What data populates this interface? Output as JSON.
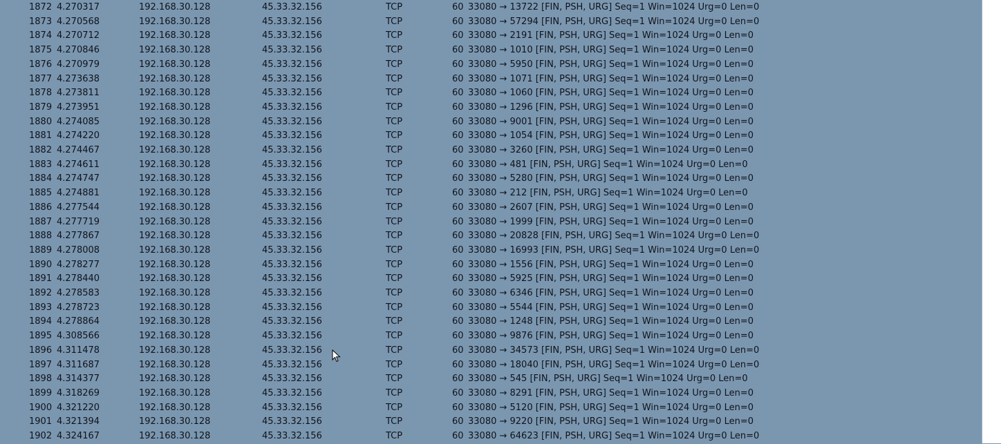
{
  "colors": {
    "row_background": "#7b97b0",
    "text": "#10131a",
    "gutter": "#ffffff"
  },
  "packets": [
    {
      "no": "1872",
      "time": "4.270317",
      "src": "192.168.30.128",
      "dst": "45.33.32.156",
      "proto": "TCP",
      "len": "60",
      "info": "33080 → 13722 [FIN, PSH, URG] Seq=1 Win=1024 Urg=0 Len=0"
    },
    {
      "no": "1873",
      "time": "4.270568",
      "src": "192.168.30.128",
      "dst": "45.33.32.156",
      "proto": "TCP",
      "len": "60",
      "info": "33080 → 57294 [FIN, PSH, URG] Seq=1 Win=1024 Urg=0 Len=0"
    },
    {
      "no": "1874",
      "time": "4.270712",
      "src": "192.168.30.128",
      "dst": "45.33.32.156",
      "proto": "TCP",
      "len": "60",
      "info": "33080 → 2191 [FIN, PSH, URG] Seq=1 Win=1024 Urg=0 Len=0"
    },
    {
      "no": "1875",
      "time": "4.270846",
      "src": "192.168.30.128",
      "dst": "45.33.32.156",
      "proto": "TCP",
      "len": "60",
      "info": "33080 → 1010 [FIN, PSH, URG] Seq=1 Win=1024 Urg=0 Len=0"
    },
    {
      "no": "1876",
      "time": "4.270979",
      "src": "192.168.30.128",
      "dst": "45.33.32.156",
      "proto": "TCP",
      "len": "60",
      "info": "33080 → 5950 [FIN, PSH, URG] Seq=1 Win=1024 Urg=0 Len=0"
    },
    {
      "no": "1877",
      "time": "4.273638",
      "src": "192.168.30.128",
      "dst": "45.33.32.156",
      "proto": "TCP",
      "len": "60",
      "info": "33080 → 1071 [FIN, PSH, URG] Seq=1 Win=1024 Urg=0 Len=0"
    },
    {
      "no": "1878",
      "time": "4.273811",
      "src": "192.168.30.128",
      "dst": "45.33.32.156",
      "proto": "TCP",
      "len": "60",
      "info": "33080 → 1060 [FIN, PSH, URG] Seq=1 Win=1024 Urg=0 Len=0"
    },
    {
      "no": "1879",
      "time": "4.273951",
      "src": "192.168.30.128",
      "dst": "45.33.32.156",
      "proto": "TCP",
      "len": "60",
      "info": "33080 → 1296 [FIN, PSH, URG] Seq=1 Win=1024 Urg=0 Len=0"
    },
    {
      "no": "1880",
      "time": "4.274085",
      "src": "192.168.30.128",
      "dst": "45.33.32.156",
      "proto": "TCP",
      "len": "60",
      "info": "33080 → 9001 [FIN, PSH, URG] Seq=1 Win=1024 Urg=0 Len=0"
    },
    {
      "no": "1881",
      "time": "4.274220",
      "src": "192.168.30.128",
      "dst": "45.33.32.156",
      "proto": "TCP",
      "len": "60",
      "info": "33080 → 1054 [FIN, PSH, URG] Seq=1 Win=1024 Urg=0 Len=0"
    },
    {
      "no": "1882",
      "time": "4.274467",
      "src": "192.168.30.128",
      "dst": "45.33.32.156",
      "proto": "TCP",
      "len": "60",
      "info": "33080 → 3260 [FIN, PSH, URG] Seq=1 Win=1024 Urg=0 Len=0"
    },
    {
      "no": "1883",
      "time": "4.274611",
      "src": "192.168.30.128",
      "dst": "45.33.32.156",
      "proto": "TCP",
      "len": "60",
      "info": "33080 → 481 [FIN, PSH, URG] Seq=1 Win=1024 Urg=0 Len=0"
    },
    {
      "no": "1884",
      "time": "4.274747",
      "src": "192.168.30.128",
      "dst": "45.33.32.156",
      "proto": "TCP",
      "len": "60",
      "info": "33080 → 5280 [FIN, PSH, URG] Seq=1 Win=1024 Urg=0 Len=0"
    },
    {
      "no": "1885",
      "time": "4.274881",
      "src": "192.168.30.128",
      "dst": "45.33.32.156",
      "proto": "TCP",
      "len": "60",
      "info": "33080 → 212 [FIN, PSH, URG] Seq=1 Win=1024 Urg=0 Len=0"
    },
    {
      "no": "1886",
      "time": "4.277544",
      "src": "192.168.30.128",
      "dst": "45.33.32.156",
      "proto": "TCP",
      "len": "60",
      "info": "33080 → 2607 [FIN, PSH, URG] Seq=1 Win=1024 Urg=0 Len=0"
    },
    {
      "no": "1887",
      "time": "4.277719",
      "src": "192.168.30.128",
      "dst": "45.33.32.156",
      "proto": "TCP",
      "len": "60",
      "info": "33080 → 1999 [FIN, PSH, URG] Seq=1 Win=1024 Urg=0 Len=0"
    },
    {
      "no": "1888",
      "time": "4.277867",
      "src": "192.168.30.128",
      "dst": "45.33.32.156",
      "proto": "TCP",
      "len": "60",
      "info": "33080 → 20828 [FIN, PSH, URG] Seq=1 Win=1024 Urg=0 Len=0"
    },
    {
      "no": "1889",
      "time": "4.278008",
      "src": "192.168.30.128",
      "dst": "45.33.32.156",
      "proto": "TCP",
      "len": "60",
      "info": "33080 → 16993 [FIN, PSH, URG] Seq=1 Win=1024 Urg=0 Len=0"
    },
    {
      "no": "1890",
      "time": "4.278277",
      "src": "192.168.30.128",
      "dst": "45.33.32.156",
      "proto": "TCP",
      "len": "60",
      "info": "33080 → 1556 [FIN, PSH, URG] Seq=1 Win=1024 Urg=0 Len=0"
    },
    {
      "no": "1891",
      "time": "4.278440",
      "src": "192.168.30.128",
      "dst": "45.33.32.156",
      "proto": "TCP",
      "len": "60",
      "info": "33080 → 5925 [FIN, PSH, URG] Seq=1 Win=1024 Urg=0 Len=0"
    },
    {
      "no": "1892",
      "time": "4.278583",
      "src": "192.168.30.128",
      "dst": "45.33.32.156",
      "proto": "TCP",
      "len": "60",
      "info": "33080 → 6346 [FIN, PSH, URG] Seq=1 Win=1024 Urg=0 Len=0"
    },
    {
      "no": "1893",
      "time": "4.278723",
      "src": "192.168.30.128",
      "dst": "45.33.32.156",
      "proto": "TCP",
      "len": "60",
      "info": "33080 → 5544 [FIN, PSH, URG] Seq=1 Win=1024 Urg=0 Len=0"
    },
    {
      "no": "1894",
      "time": "4.278864",
      "src": "192.168.30.128",
      "dst": "45.33.32.156",
      "proto": "TCP",
      "len": "60",
      "info": "33080 → 1248 [FIN, PSH, URG] Seq=1 Win=1024 Urg=0 Len=0"
    },
    {
      "no": "1895",
      "time": "4.308566",
      "src": "192.168.30.128",
      "dst": "45.33.32.156",
      "proto": "TCP",
      "len": "60",
      "info": "33080 → 9876 [FIN, PSH, URG] Seq=1 Win=1024 Urg=0 Len=0"
    },
    {
      "no": "1896",
      "time": "4.311478",
      "src": "192.168.30.128",
      "dst": "45.33.32.156",
      "proto": "TCP",
      "len": "60",
      "info": "33080 → 34573 [FIN, PSH, URG] Seq=1 Win=1024 Urg=0 Len=0"
    },
    {
      "no": "1897",
      "time": "4.311687",
      "src": "192.168.30.128",
      "dst": "45.33.32.156",
      "proto": "TCP",
      "len": "60",
      "info": "33080 → 18040 [FIN, PSH, URG] Seq=1 Win=1024 Urg=0 Len=0"
    },
    {
      "no": "1898",
      "time": "4.314377",
      "src": "192.168.30.128",
      "dst": "45.33.32.156",
      "proto": "TCP",
      "len": "60",
      "info": "33080 → 545 [FIN, PSH, URG] Seq=1 Win=1024 Urg=0 Len=0"
    },
    {
      "no": "1899",
      "time": "4.318269",
      "src": "192.168.30.128",
      "dst": "45.33.32.156",
      "proto": "TCP",
      "len": "60",
      "info": "33080 → 8291 [FIN, PSH, URG] Seq=1 Win=1024 Urg=0 Len=0"
    },
    {
      "no": "1900",
      "time": "4.321220",
      "src": "192.168.30.128",
      "dst": "45.33.32.156",
      "proto": "TCP",
      "len": "60",
      "info": "33080 → 5120 [FIN, PSH, URG] Seq=1 Win=1024 Urg=0 Len=0"
    },
    {
      "no": "1901",
      "time": "4.321394",
      "src": "192.168.30.128",
      "dst": "45.33.32.156",
      "proto": "TCP",
      "len": "60",
      "info": "33080 → 9220 [FIN, PSH, URG] Seq=1 Win=1024 Urg=0 Len=0"
    },
    {
      "no": "1902",
      "time": "4.324167",
      "src": "192.168.30.128",
      "dst": "45.33.32.156",
      "proto": "TCP",
      "len": "60",
      "info": "33080 → 64623 [FIN, PSH, URG] Seq=1 Win=1024 Urg=0 Len=0"
    }
  ]
}
